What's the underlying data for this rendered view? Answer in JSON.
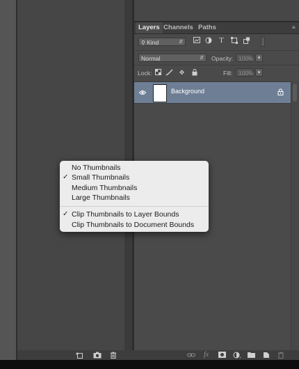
{
  "panel": {
    "tabs": [
      {
        "label": "Layers",
        "active": true
      },
      {
        "label": "Channels",
        "active": false
      },
      {
        "label": "Paths",
        "active": false
      }
    ],
    "menu_glyph": "≡"
  },
  "filter": {
    "kind_label": "Kind",
    "kind_icon": "search-icon",
    "filter_icons": [
      "image-filter-icon",
      "adjustment-filter-icon",
      "type-filter-icon",
      "shape-filter-icon",
      "smart-object-filter-icon"
    ]
  },
  "mode": {
    "blend_mode": "Normal",
    "opacity_label": "Opacity:",
    "opacity_value": "100%"
  },
  "lock": {
    "lock_label": "Lock:",
    "fill_label": "Fill:",
    "fill_value": "100%",
    "lock_icons": [
      "lock-transparent-icon",
      "lock-paint-icon",
      "lock-move-icon",
      "lock-all-icon"
    ]
  },
  "layers": [
    {
      "name": "Background",
      "visible": true,
      "locked": true
    }
  ],
  "context_menu": {
    "items": [
      {
        "label": "No Thumbnails",
        "checked": false
      },
      {
        "label": "Small Thumbnails",
        "checked": true
      },
      {
        "label": "Medium Thumbnails",
        "checked": false
      },
      {
        "label": "Large Thumbnails",
        "checked": false
      },
      {
        "label": "Clip Thumbnails to Layer Bounds",
        "checked": true
      },
      {
        "label": "Clip Thumbnails to Document Bounds",
        "checked": false
      }
    ],
    "check_glyph": "✓"
  },
  "bottom_bar": {
    "left_icons": [
      "new-group-icon",
      "camera-icon",
      "trash-icon"
    ],
    "right_icons": [
      "link-layers-icon",
      "fx-icon",
      "mask-icon",
      "adjustment-layer-icon",
      "folder-icon",
      "new-layer-icon",
      "delete-layer-icon"
    ],
    "fx_text": "fx"
  },
  "colors": {
    "selected_layer": "#6e7e95",
    "panel_bg": "#4a4a4a",
    "menu_bg": "#ececec"
  }
}
